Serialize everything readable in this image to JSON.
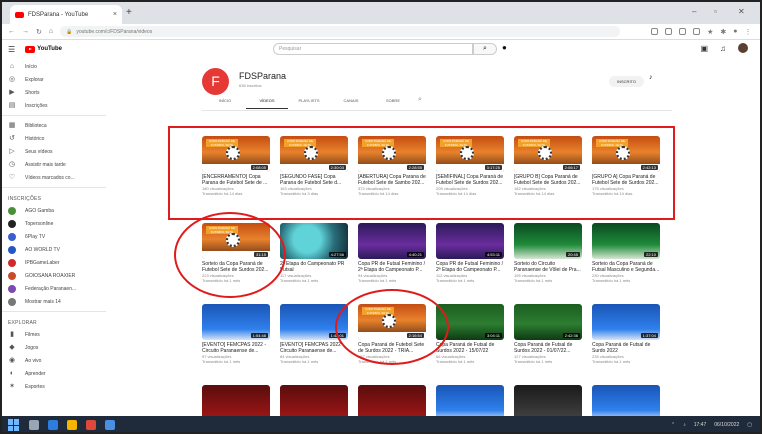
{
  "browser": {
    "tab_title": "FDSParana - YouTube",
    "tab_close": "×",
    "new_tab": "+",
    "url": "youtube.com/c/FDSParana/videos",
    "window_controls": [
      "–",
      "▫",
      "✕"
    ]
  },
  "header": {
    "logo_text": "YouTube",
    "search_placeholder": "Pesquisar",
    "search_icon": "⌕",
    "mic_icon": "🎙"
  },
  "sidebar": {
    "main": [
      "Início",
      "Explorar",
      "Shorts",
      "Inscrições"
    ],
    "library": [
      "Biblioteca",
      "Histórico",
      "Seus vídeos",
      "Assistir mais tarde",
      "Vídeos marcados co..."
    ],
    "subs_header": "INSCRIÇÕES",
    "subs": [
      "AGO Gamba",
      "Topersonline",
      "6Play TV",
      "AO WORLD TV",
      "IPBGameLaber",
      "GOIOSANA ROAXIER",
      "Federação Paranaen...",
      "Mostrar mais 14"
    ],
    "sub_colors": [
      "#4a8f3a",
      "#222222",
      "#3a5fd0",
      "#2456c8",
      "#d02a2a",
      "#c94b2a",
      "#7a4bb0",
      "#777777"
    ],
    "explore_header": "EXPLORAR",
    "explore": [
      "Filmes",
      "Jogos",
      "Ao vivo",
      "Aprender",
      "Esportes"
    ]
  },
  "channel": {
    "avatar_letter": "F",
    "name": "FDSParana",
    "subs": "636 inscritos",
    "subscribe": "INSCRITO",
    "tabs": [
      "INÍCIO",
      "VÍDEOS",
      "PLAYLISTS",
      "CANAIS",
      "SOBRE"
    ]
  },
  "videos": [
    {
      "title": "[ENCERRAMENTO] Copa Parana de Futebol Sete de ...",
      "meta": "180 visualizações",
      "age": "Transmitido há 14 dias",
      "dur": "2:08:05",
      "style": "orange"
    },
    {
      "title": "[SEGUNDO FASE] Copa Parana de Futebol Sete d...",
      "meta": "163 visualizações",
      "age": "Transmitido há 3 dias",
      "dur": "2:30:03",
      "style": "orange"
    },
    {
      "title": "[ABERTURA] Copa Parana de Futebol Sete de Sambo 202...",
      "meta": "372 visualizações",
      "age": "Transmitido há 14 dias",
      "dur": "2:28:55",
      "style": "orange"
    },
    {
      "title": "[SEMIFINAL] Copa Paraná de Futebol Sete de Surdos 202...",
      "meta": "205 visualizações",
      "age": "Transmitido há 14 dias",
      "dur": "3:17:25",
      "style": "orange"
    },
    {
      "title": "[GRUPO B] Copa Paraná de Futebol Sete de Surdos 202...",
      "meta": "182 visualizações",
      "age": "Transmitido há 14 dias",
      "dur": "2:06:17",
      "style": "orange"
    },
    {
      "title": "[GRUPO A] Copa Paraná de Futebol Sete de Surdos 202...",
      "meta": "175 visualizações",
      "age": "Transmitido há 14 dias",
      "dur": "2:42:13",
      "style": "orange"
    },
    {
      "title": "Sorteio da Copa Paraná de Futebol Sete de Surdos 202...",
      "meta": "223 visualizações",
      "age": "Transmitido há 1 mês",
      "dur": "31:15",
      "style": "orange"
    },
    {
      "title": "2ª Etapa do Campeonato PR Futsal",
      "meta": "117 visualizações",
      "age": "Transmitido há 1 mês",
      "dur": "4:27:56",
      "style": "teal"
    },
    {
      "title": "Copa PR de Futsal Feminino / 2ª Etapa do Campeonato P...",
      "meta": "94 visualizações",
      "age": "Transmitido há 1 mês",
      "dur": "4:40:21",
      "style": "purple"
    },
    {
      "title": "Copa PR de Futsal Feminino / 2ª Etapa do Campeonato P...",
      "meta": "112 visualizações",
      "age": "Transmitido há 1 mês",
      "dur": "4:53:11",
      "style": "purple"
    },
    {
      "title": "Sorteio do Circuito Paranaense de Vôlei de Pra...",
      "meta": "195 visualizações",
      "age": "Transmitido há 1 mês",
      "dur": "20:45",
      "style": "green"
    },
    {
      "title": "Sorteio da Copa Paraná de Futsal Masculino e Segunda...",
      "meta": "230 visualizações",
      "age": "Transmitido há 1 mês",
      "dur": "22:10",
      "style": "green"
    },
    {
      "title": "[EVENTO] FEMCPAS 2022 - Circuito Paranaense de...",
      "meta": "97 visualizações",
      "age": "Transmitido há 1 mês",
      "dur": "1:54:48",
      "style": "blue"
    },
    {
      "title": "[EVENTO] FEMCPAS 2022 - Circuito Paranaense de...",
      "meta": "84 visualizações",
      "age": "Transmitido há 1 mês",
      "dur": "1:48:01",
      "style": "blue"
    },
    {
      "title": "Copa Paraná de Futebol Sete de Surdos 2022 - TRIA...",
      "meta": "157 visualizações",
      "age": "Transmitido há 1 mês",
      "dur": "2:16:54",
      "style": "orange"
    },
    {
      "title": "Copa Paraná de Futsal de Surdos 2022 - 15/07/22",
      "meta": "66 visualizações",
      "age": "Transmitido há 1 mês",
      "dur": "3:04:11",
      "style": "field"
    },
    {
      "title": "Copa Paraná de Futsal de Surdos 2022 - 01/07/22...",
      "meta": "127 visualizações",
      "age": "Transmitido há 1 mês",
      "dur": "2:42:36",
      "style": "field"
    },
    {
      "title": "Copa Paraná de Futsal de Surdo 2022",
      "meta": "235 visualizações",
      "age": "Transmitido há 1 mês",
      "dur": "1:37:04",
      "style": "blue"
    },
    {
      "title": "",
      "meta": "",
      "age": "",
      "dur": "",
      "style": "red"
    },
    {
      "title": "",
      "meta": "",
      "age": "",
      "dur": "",
      "style": "red"
    },
    {
      "title": "",
      "meta": "",
      "age": "",
      "dur": "",
      "style": "red"
    },
    {
      "title": "",
      "meta": "",
      "age": "",
      "dur": "",
      "style": "blue"
    },
    {
      "title": "",
      "meta": "",
      "age": "",
      "dur": "",
      "style": "dark"
    },
    {
      "title": "",
      "meta": "",
      "age": "",
      "dur": "",
      "style": "blue"
    }
  ],
  "thumb_banner": "COPA PARANÁ DE FUTEBOL SETE",
  "taskbar": {
    "time": "17:47",
    "date": "06/10/2022"
  }
}
